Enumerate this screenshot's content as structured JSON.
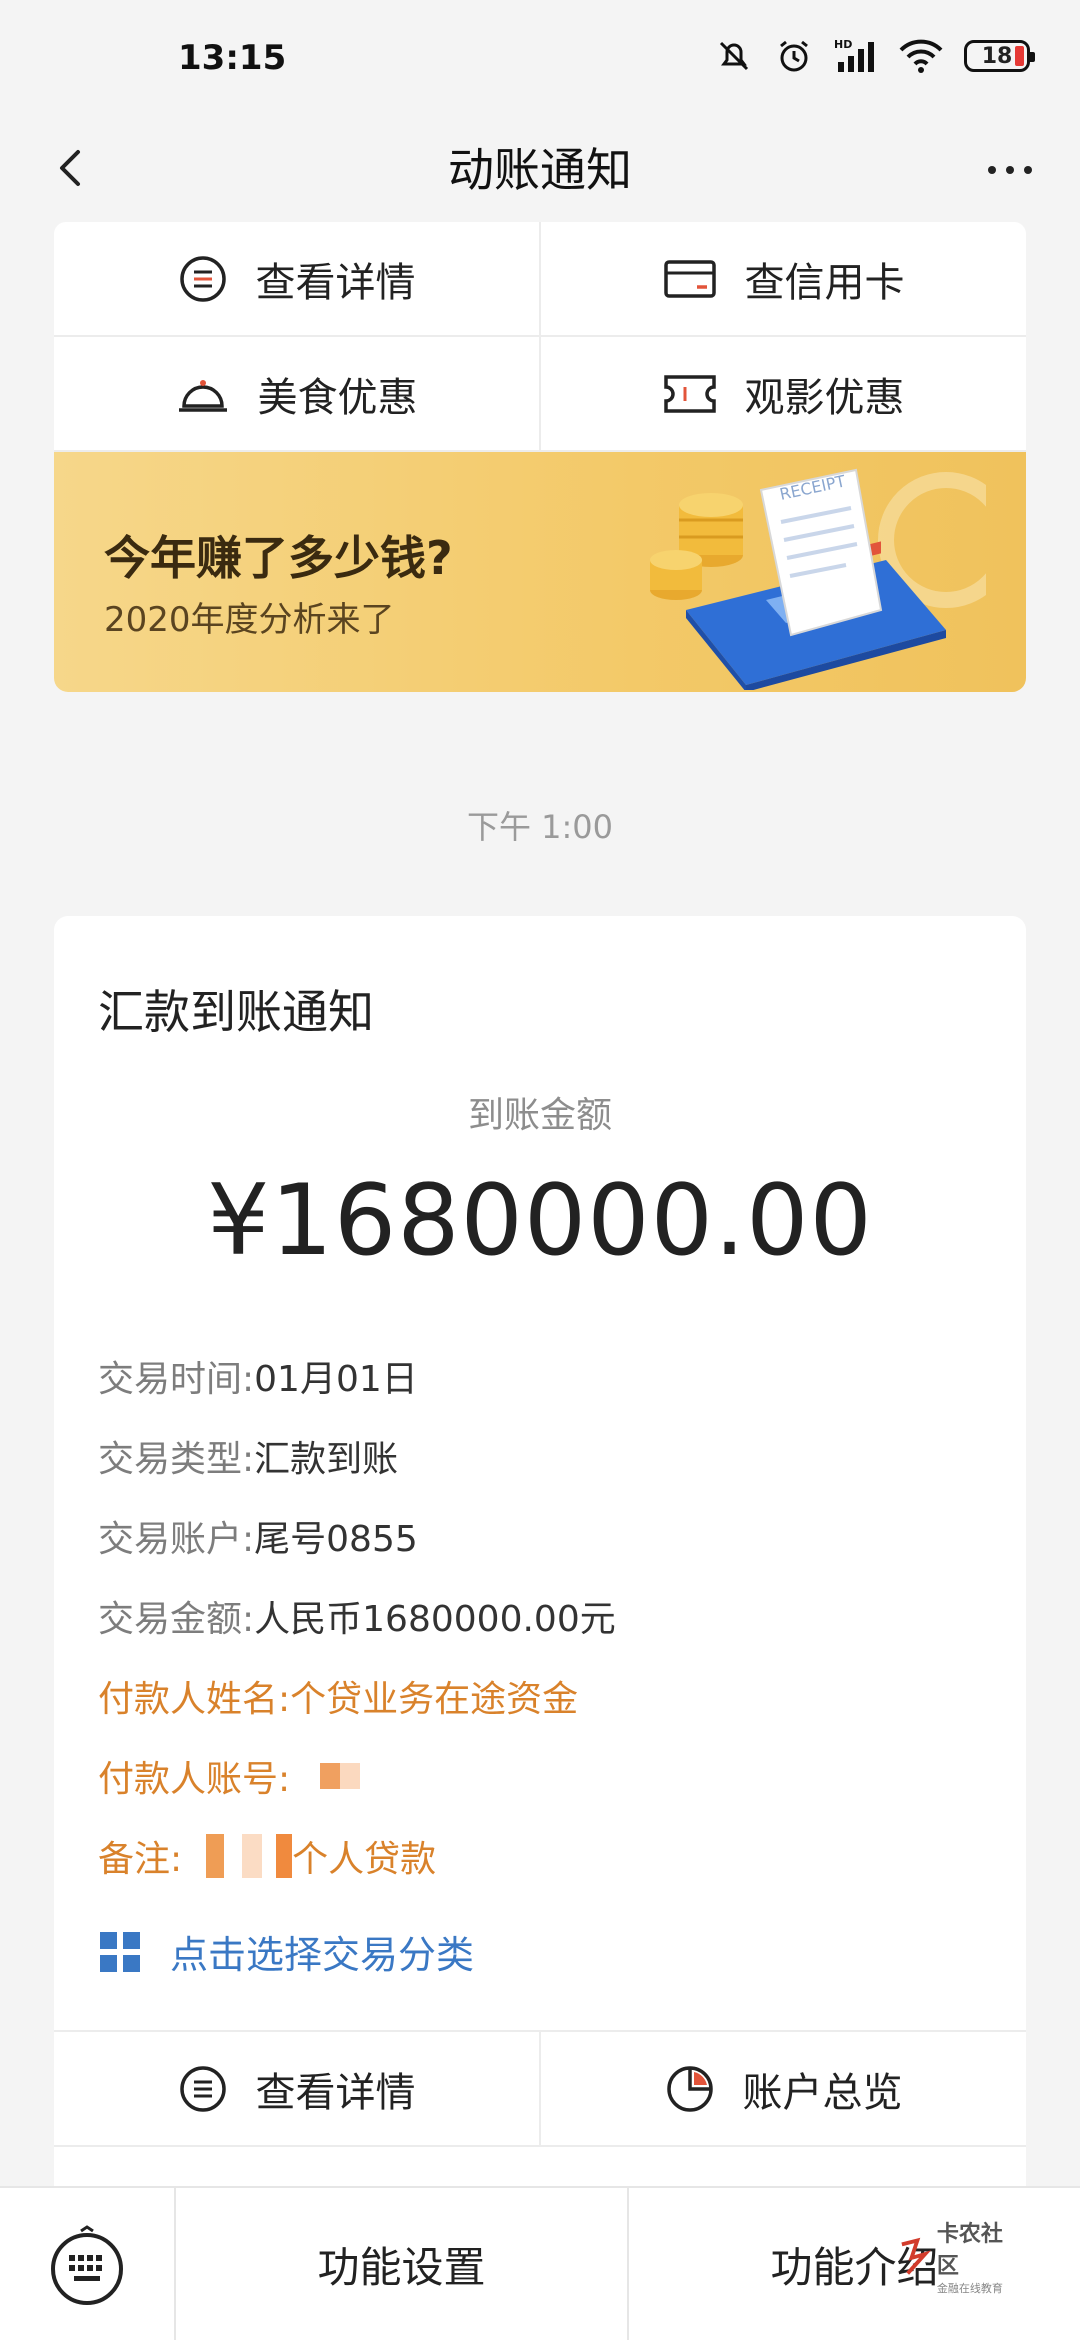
{
  "status_bar": {
    "time": "13:15",
    "battery": "18"
  },
  "nav": {
    "title": "动账通知"
  },
  "top_menu": [
    {
      "label": "查看详情",
      "icon": "list-circle-icon"
    },
    {
      "label": "查信用卡",
      "icon": "card-icon"
    },
    {
      "label": "美食优惠",
      "icon": "food-cloche-icon"
    },
    {
      "label": "观影优惠",
      "icon": "ticket-icon"
    }
  ],
  "banner": {
    "title": "今年赚了多少钱?",
    "subtitle": "2020年度分析来了",
    "receipt_text": "RECEIPT"
  },
  "message": {
    "time": "下午 1:00",
    "title": "汇款到账通知",
    "amount_label": "到账金额",
    "amount": "¥1680000.00",
    "details": [
      {
        "key": "交易时间:",
        "value": "01月01日",
        "highlight": false
      },
      {
        "key": "交易类型:",
        "value": "汇款到账",
        "highlight": false
      },
      {
        "key": "交易账户:",
        "value": "尾号0855",
        "highlight": false
      },
      {
        "key": "交易金额:",
        "value": "人民币1680000.00元",
        "highlight": false
      },
      {
        "key": "付款人姓名:",
        "value": "个贷业务在途资金",
        "highlight": true
      },
      {
        "key": "付款人账号:",
        "value": "",
        "highlight": true
      },
      {
        "key": "备注:",
        "value": "个人贷款",
        "highlight": true
      }
    ],
    "classify_label": "点击选择交易分类"
  },
  "bottom_menu": [
    {
      "label": "查看详情",
      "icon": "list-circle-icon"
    },
    {
      "label": "账户总览",
      "icon": "pie-chart-icon"
    }
  ],
  "bottom_bar": {
    "left": "功能设置",
    "right": "功能介绍"
  },
  "watermark": {
    "main": "卡农社区",
    "sub": "金融在线教育"
  },
  "colors": {
    "accent_orange": "#d9822b",
    "link_blue": "#3a78c4",
    "banner_gold": "#f3c968"
  }
}
